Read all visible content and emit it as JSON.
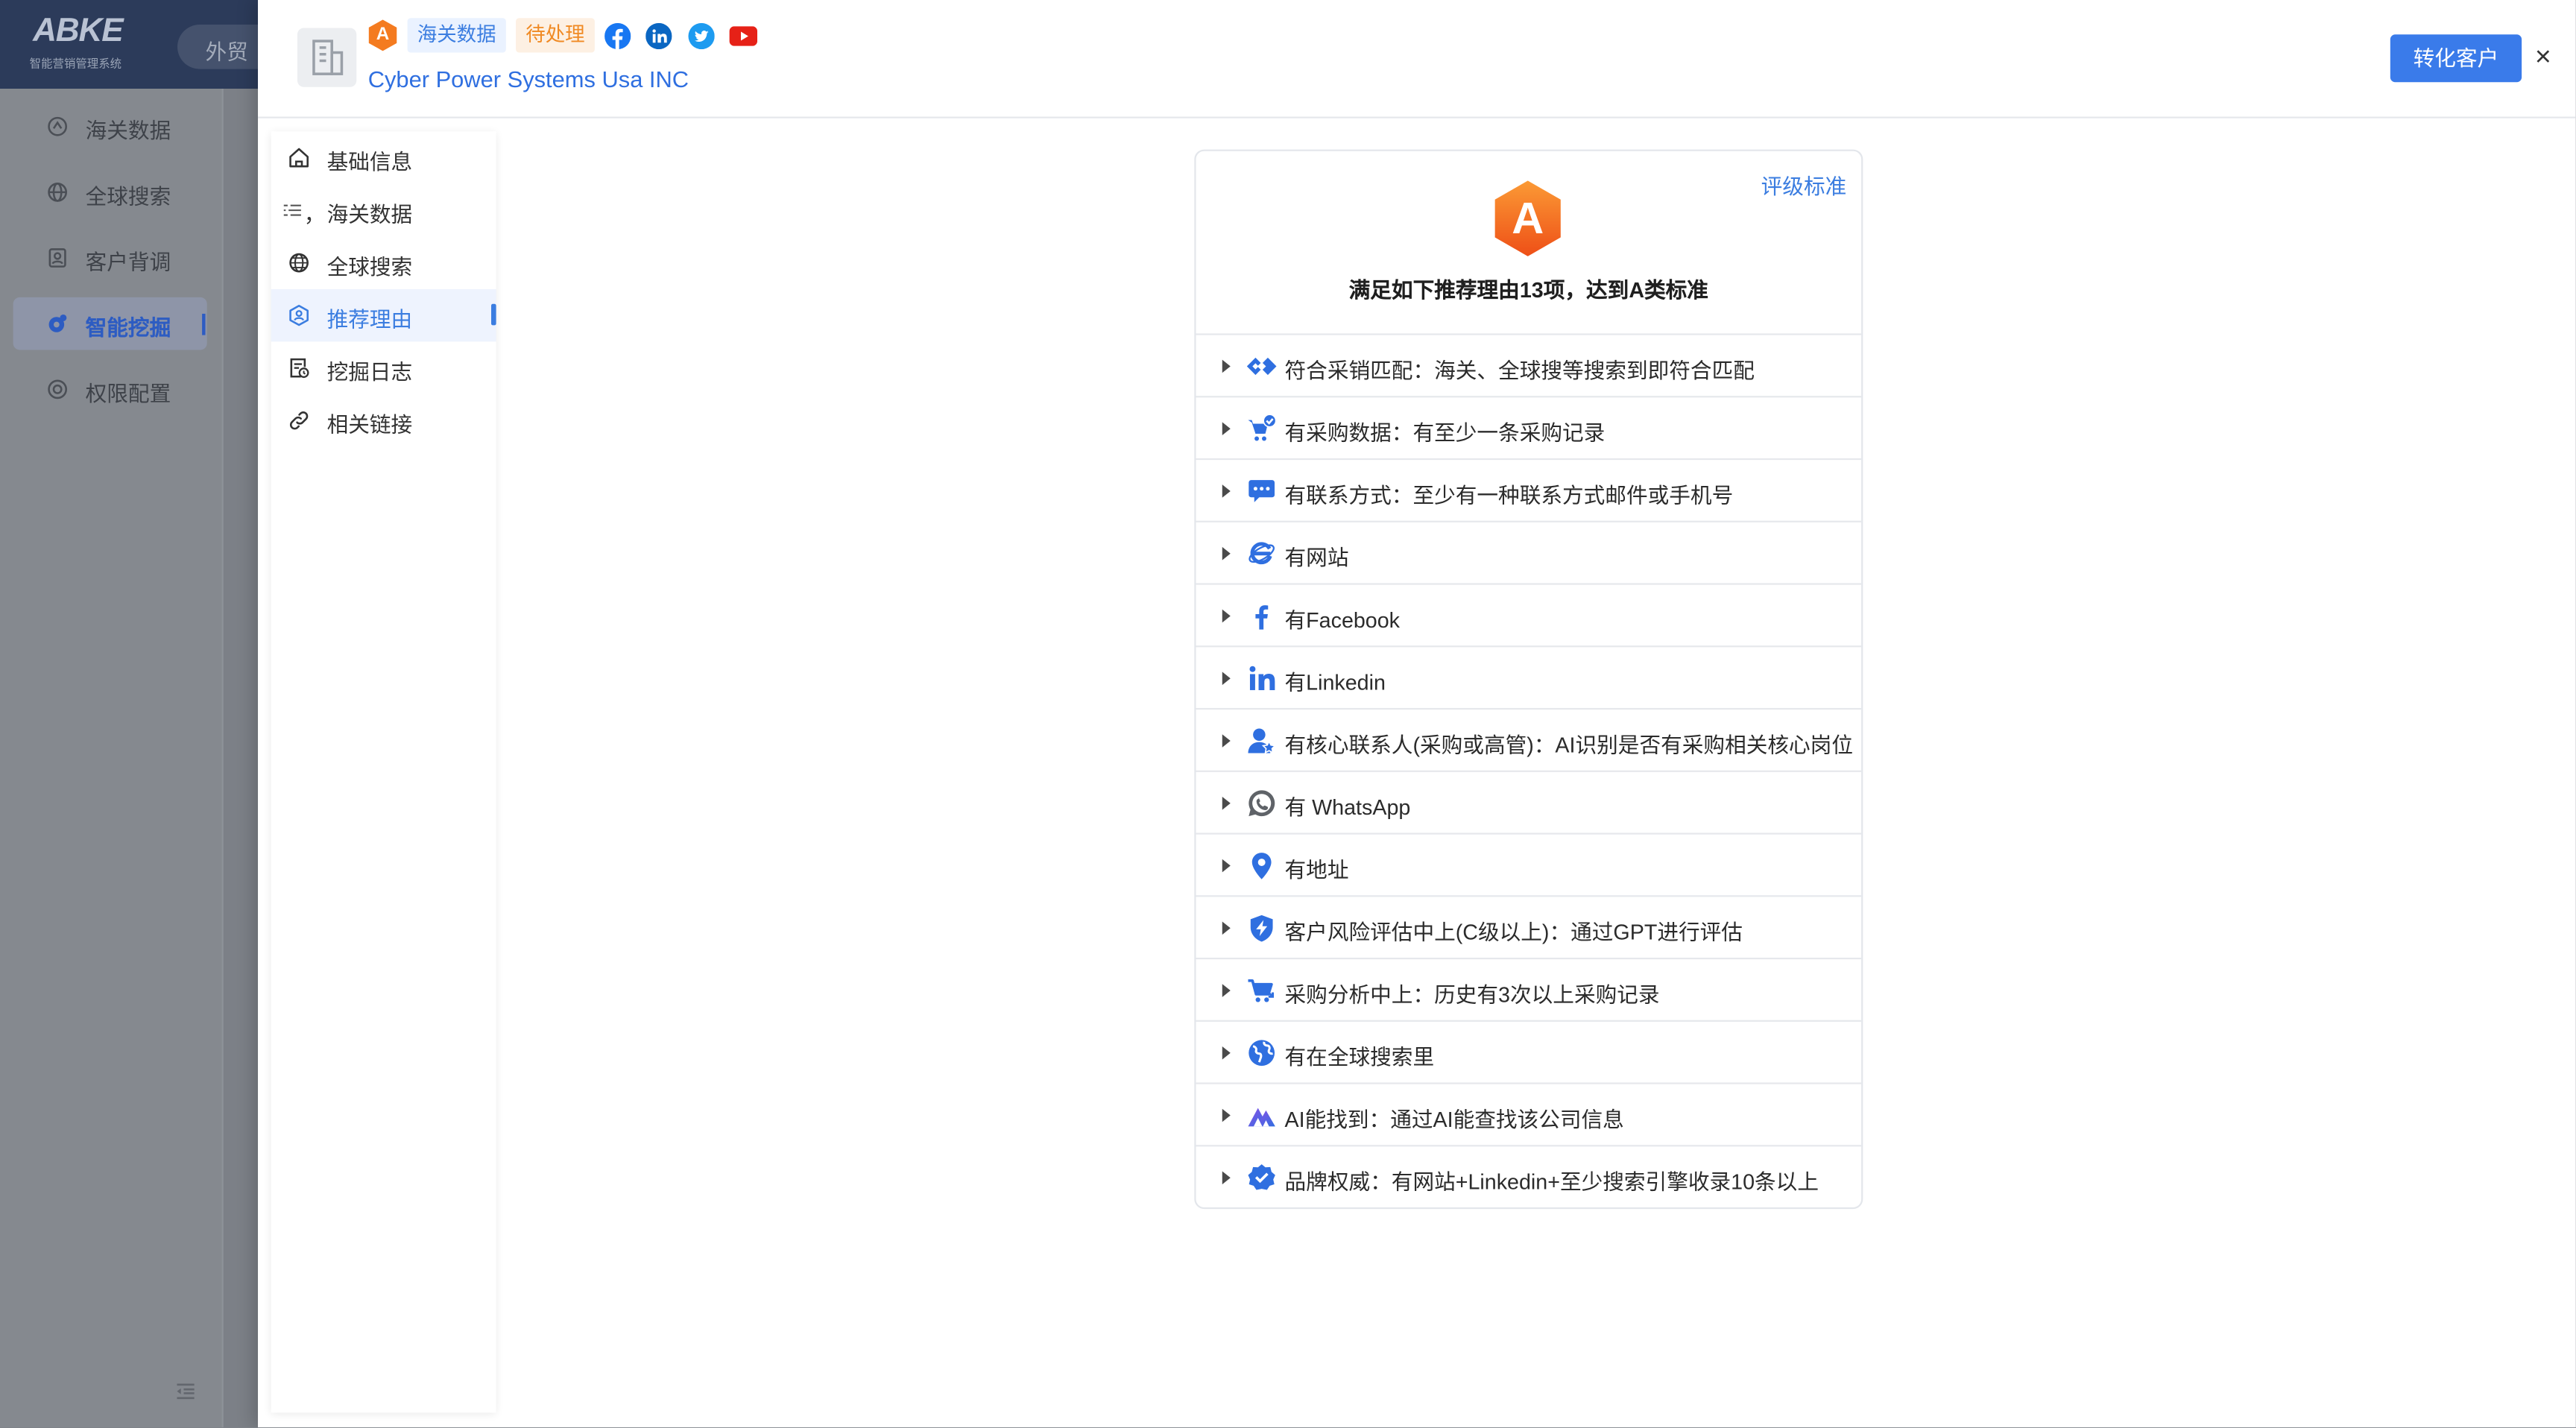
{
  "app": {
    "logo_text": "ABKE",
    "logo_subtitle": "智能营销管理系统",
    "top_tab": "外贸",
    "sidebar": {
      "items": [
        {
          "label": "海关数据",
          "icon": "customs-icon"
        },
        {
          "label": "全球搜索",
          "icon": "globe-icon"
        },
        {
          "label": "客户背调",
          "icon": "profile-icon"
        },
        {
          "label": "智能挖掘",
          "icon": "mining-icon",
          "active": true
        },
        {
          "label": "权限配置",
          "icon": "settings-icon"
        }
      ]
    }
  },
  "drawer": {
    "header": {
      "grade": "A",
      "tags": [
        {
          "label": "海关数据",
          "color": "#3b7de0"
        },
        {
          "label": "待处理",
          "color": "#f08a24"
        }
      ],
      "social_links": [
        "facebook-icon",
        "linkedin-icon",
        "twitter-icon",
        "youtube-icon"
      ],
      "company_name": "Cyber Power Systems Usa INC",
      "convert_button": "转化客户",
      "close_label": "×"
    },
    "nav": {
      "items": [
        {
          "label": "基础信息",
          "icon": "home-icon"
        },
        {
          "label": "海关数据",
          "icon": "list-icon",
          "prefix": "，"
        },
        {
          "label": "全球搜索",
          "icon": "globe-icon"
        },
        {
          "label": "推荐理由",
          "icon": "recommend-icon",
          "active": true
        },
        {
          "label": "挖掘日志",
          "icon": "log-icon"
        },
        {
          "label": "相关链接",
          "icon": "link-icon"
        }
      ]
    },
    "recommendation": {
      "criteria_link": "评级标准",
      "grade": "A",
      "summary": "满足如下推荐理由13项，达到A类标准",
      "reasons": [
        {
          "text": "符合采销匹配：海关、全球搜等搜索到即符合匹配",
          "icon": "match-icon"
        },
        {
          "text": "有采购数据：有至少一条采购记录",
          "icon": "cart-check-icon"
        },
        {
          "text": "有联系方式：至少有一种联系方式邮件或手机号",
          "icon": "chat-icon"
        },
        {
          "text": "有网站",
          "icon": "website-icon"
        },
        {
          "text": "有Facebook",
          "icon": "facebook-icon"
        },
        {
          "text": "有Linkedin",
          "icon": "linkedin-icon"
        },
        {
          "text": "有核心联系人(采购或高管)：AI识别是否有采购相关核心岗位",
          "icon": "key-contact-icon"
        },
        {
          "text": "有 WhatsApp",
          "icon": "whatsapp-icon"
        },
        {
          "text": "有地址",
          "icon": "location-icon"
        },
        {
          "text": "客户风险评估中上(C级以上)：通过GPT进行评估",
          "icon": "risk-shield-icon"
        },
        {
          "text": "采购分析中上：历史有3次以上采购记录",
          "icon": "purchase-analysis-icon"
        },
        {
          "text": "有在全球搜索里",
          "icon": "global-search-icon"
        },
        {
          "text": "AI能找到：通过AI能查找该公司信息",
          "icon": "ai-icon"
        },
        {
          "text": "品牌权威：有网站+Linkedin+至少搜索引擎收录10条以上",
          "icon": "brand-authority-icon"
        }
      ]
    }
  },
  "colors": {
    "primary": "#3a7bea",
    "link_blue": "#2f6fe0",
    "grade_orange": "#f47b20",
    "tag_orange": "#f08a24"
  }
}
